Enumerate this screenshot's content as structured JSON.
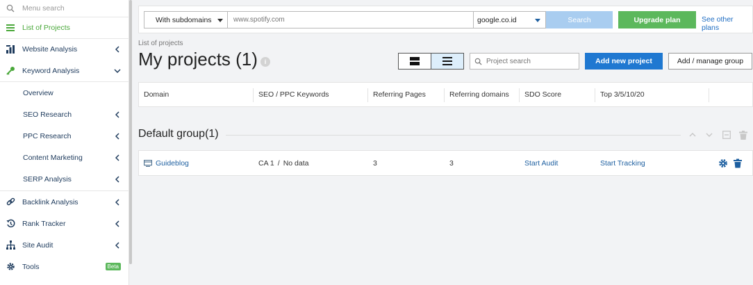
{
  "sidebar": {
    "search_placeholder": "Menu search",
    "items": [
      {
        "label": "List of Projects"
      },
      {
        "label": "Website Analysis"
      },
      {
        "label": "Keyword Analysis"
      },
      {
        "label": "Overview"
      },
      {
        "label": "SEO Research"
      },
      {
        "label": "PPC Research"
      },
      {
        "label": "Content Marketing"
      },
      {
        "label": "SERP Analysis"
      },
      {
        "label": "Backlink Analysis"
      },
      {
        "label": "Rank Tracker"
      },
      {
        "label": "Site Audit"
      },
      {
        "label": "Tools",
        "badge": "Beta"
      }
    ]
  },
  "topbar": {
    "subdomain_select": "With subdomains",
    "url_placeholder": "www.spotify.com",
    "engine_select": "google.co.id",
    "search_label": "Search",
    "upgrade_label": "Upgrade plan",
    "plans_link": "See other plans"
  },
  "page": {
    "breadcrumb": "List of projects",
    "title": "My projects (1)",
    "info_icon": "i",
    "project_search_placeholder": "Project search",
    "add_project_label": "Add new project",
    "manage_group_label": "Add / manage group"
  },
  "table": {
    "columns": [
      "Domain",
      "SEO / PPC Keywords",
      "Referring Pages",
      "Referring domains",
      "SDO Score",
      "Top 3/5/10/20"
    ]
  },
  "group": {
    "title": "Default group(1)",
    "rows": [
      {
        "domain": "Guideblog",
        "keywords_country": "CA 1",
        "keywords_sep": "/",
        "keywords_value": "No data",
        "referring_pages": "3",
        "referring_domains": "3",
        "sdo_action": "Start Audit",
        "top_action": "Start Tracking"
      }
    ]
  },
  "colors": {
    "accent_green": "#5cb85c",
    "accent_blue": "#1f78d1",
    "link_blue": "#1d5fa0",
    "sidebar_text": "#1d3a5c"
  },
  "icons": {
    "menu_search": "search-icon",
    "list_of_projects": "list-icon",
    "website_analysis": "chart-icon",
    "keyword_analysis": "key-icon",
    "backlink_analysis": "link-icon",
    "rank_tracker": "history-icon",
    "site_audit": "sitemap-icon",
    "tools": "gear-icon"
  }
}
